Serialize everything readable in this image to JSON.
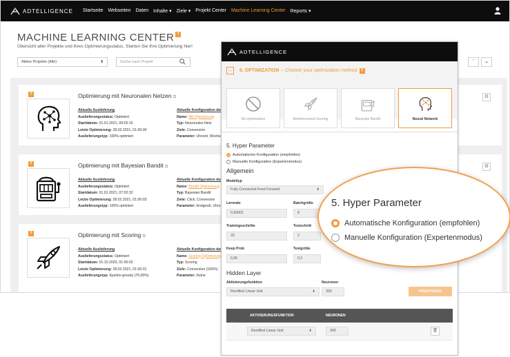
{
  "nav": {
    "brand": "ADTELLIGENCE",
    "items": [
      "Startseite",
      "Webseiten",
      "Daten",
      "Inhalte ▾",
      "Ziele ▾",
      "Projekt Center",
      "Machine Learning Center",
      "Reports ▾"
    ],
    "active_index": 6
  },
  "page": {
    "title": "MACHINE LEARNING CENTER",
    "title_badge": "?",
    "subtitle": "Übersicht aller Projekte und ihres Optimierungsstatus. Starten Sie Ihre Optimierung hier!",
    "filter_value": "Aktive Projekte (Alle)",
    "search_placeholder": "Suche nach Projekt",
    "sort_up": "⌃",
    "sort_down": "⌄"
  },
  "cards": [
    {
      "title": "Optimierung mit Neuronalen Netzen",
      "icon": "brain-network-icon",
      "left": {
        "header": "Aktuelle Auslieferung",
        "rows": [
          {
            "k": "Auslieferungsstatus:",
            "v": "Optimiert"
          },
          {
            "k": "Startdatum:",
            "v": "01.01.2021, 09:02:15"
          },
          {
            "k": "Letzte Optimierung:",
            "v": "28.02.2021, 01:00:00"
          },
          {
            "k": "Auslieferungstyp:",
            "v": "100% optimiert"
          }
        ]
      },
      "right": {
        "header": "Aktuelle Konfiguration der O",
        "rows": [
          {
            "k": "Name:",
            "v": "NN Optimierung"
          },
          {
            "k": "Typ:",
            "v": "Neuronales Netz"
          },
          {
            "k": "Ziele:",
            "v": "Conversion"
          },
          {
            "k": "Parameter:",
            "v": "Uhrzeit, Wochen"
          }
        ]
      }
    },
    {
      "title": "Optimierung mit Bayesian Bandit",
      "icon": "slot-machine-icon",
      "left": {
        "header": "Aktuelle Auslieferung",
        "rows": [
          {
            "k": "Auslieferungsstatus:",
            "v": "Optimiert"
          },
          {
            "k": "Startdatum:",
            "v": "01.01.2021, 07:02:32"
          },
          {
            "k": "Letzte Optimierung:",
            "v": "28.02.2021, 01:00:03"
          },
          {
            "k": "Auslieferungstyp:",
            "v": "100% optimiert"
          }
        ]
      },
      "right": {
        "header": "Aktuelle Konfiguration der O",
        "rows": [
          {
            "k": "Name:",
            "v": "Bandit Optimierung"
          },
          {
            "k": "Typ:",
            "v": "Bayesian Bandit"
          },
          {
            "k": "Ziele:",
            "v": "Click, Conversion"
          },
          {
            "k": "Parameter:",
            "v": "Endgerät, Uhrzei"
          }
        ]
      }
    },
    {
      "title": "Optimierung mit Scoring",
      "icon": "rocket-icon",
      "left": {
        "header": "Aktuelle Auslieferung",
        "rows": [
          {
            "k": "Auslieferungsstatus:",
            "v": "Optimiert"
          },
          {
            "k": "Startdatum:",
            "v": "01.10.2020, 01:00:02"
          },
          {
            "k": "Letzte Optimierung:",
            "v": "28.02.2021, 01:00:01"
          },
          {
            "k": "Auslieferungstyp:",
            "v": "Epsilon-greedy (75,00%)"
          }
        ]
      },
      "right": {
        "header": "Aktuelle Konfiguration der O",
        "rows": [
          {
            "k": "Name:",
            "v": "Scoring Optimierung"
          },
          {
            "k": "Typ:",
            "v": "Scoring"
          },
          {
            "k": "Ziele:",
            "v": "Conversion (100%)"
          },
          {
            "k": "Parameter:",
            "v": "Keine"
          }
        ]
      }
    }
  ],
  "modal": {
    "brand": "ADTELLIGENCE",
    "step_number": "6. OPTIMIZATION",
    "step_text": "– Choose your optimization method",
    "methods": [
      "No optimization",
      "Reinforcement Scoring",
      "Bayesian Bandit",
      "Neural Network"
    ],
    "selected_method": 3,
    "hyper_title": "5. Hyper Parameter",
    "radio_auto": "Automatische Konfiguration (empfohlen)",
    "radio_manual": "Manuelle Konfiguration (Expertenmodus)",
    "allgemein": "Allgemein",
    "modeltyp_label": "Modeltyp",
    "modeltyp_value": "Fully Connected Feed Forward",
    "lernrate_label": "Lernrate",
    "lernrate_value": "0,00001",
    "batch_label": "Batchgröße",
    "batch_value": "8",
    "training_label": "Trainingsschritte",
    "training_value": "20",
    "test_label": "Testschritt",
    "test_value": "2",
    "keep_label": "Keep Prob",
    "keep_value": "0,95",
    "testgr_label": "Testgröße",
    "testgr_value": "0,2",
    "hidden_title": "Hidden Layer",
    "act_label": "Aktivierungsfunktion",
    "act_value": "Rectified Linear Unit",
    "neuron_label": "Neuronen",
    "neuron_value": "300",
    "add_button": "HINZUFÜGEN",
    "table_col1": "AKTIVIERUNGSFUNKTION",
    "table_col2": "NEURONEN",
    "row_act": "Rectified Linear Unit",
    "row_neuron": "300"
  },
  "zoom": {
    "title": "5. Hyper Parameter",
    "radio_auto": "Automatische Konfiguration (empfohlen)",
    "radio_manual": "Manuelle Konfiguration (Expertenmodus)"
  },
  "colors": {
    "accent": "#f29a38",
    "nav_bg": "#0d0d0d"
  }
}
